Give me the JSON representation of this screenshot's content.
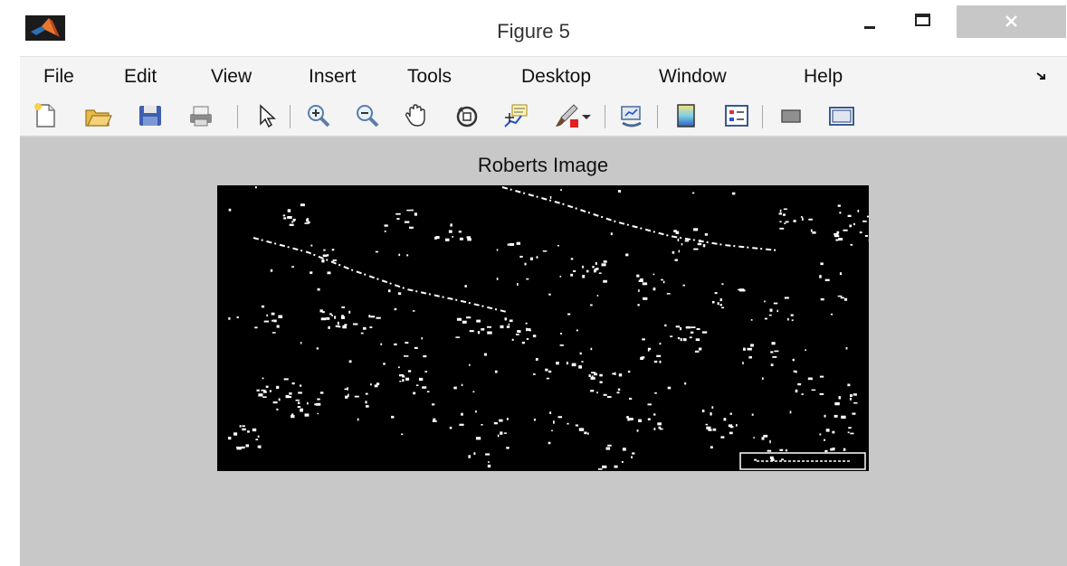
{
  "window": {
    "title": "Figure 5",
    "icons": {
      "app": "matlab-logo-icon",
      "minimize": "minimize-icon",
      "maximize": "maximize-icon",
      "close": "close-icon"
    }
  },
  "menu": {
    "items": [
      "File",
      "Edit",
      "View",
      "Insert",
      "Tools",
      "Desktop",
      "Window",
      "Help"
    ],
    "dock_icon": "dock-arrow-icon"
  },
  "toolbar": {
    "tools": [
      "new-figure-icon",
      "open-file-icon",
      "save-icon",
      "print-icon",
      "edit-plot-arrow-icon",
      "zoom-in-icon",
      "zoom-out-icon",
      "pan-hand-icon",
      "rotate-3d-icon",
      "data-cursor-icon",
      "brush-icon",
      "brush-dropdown-icon",
      "link-plot-icon",
      "insert-colorbar-icon",
      "insert-legend-icon",
      "hide-plot-tools-icon",
      "show-plot-tools-icon"
    ]
  },
  "axes": {
    "title": "Roberts Image",
    "image_description_colors": {
      "background": "#000000",
      "edges": "#ffffff",
      "figure": "#c8c8c8"
    }
  }
}
